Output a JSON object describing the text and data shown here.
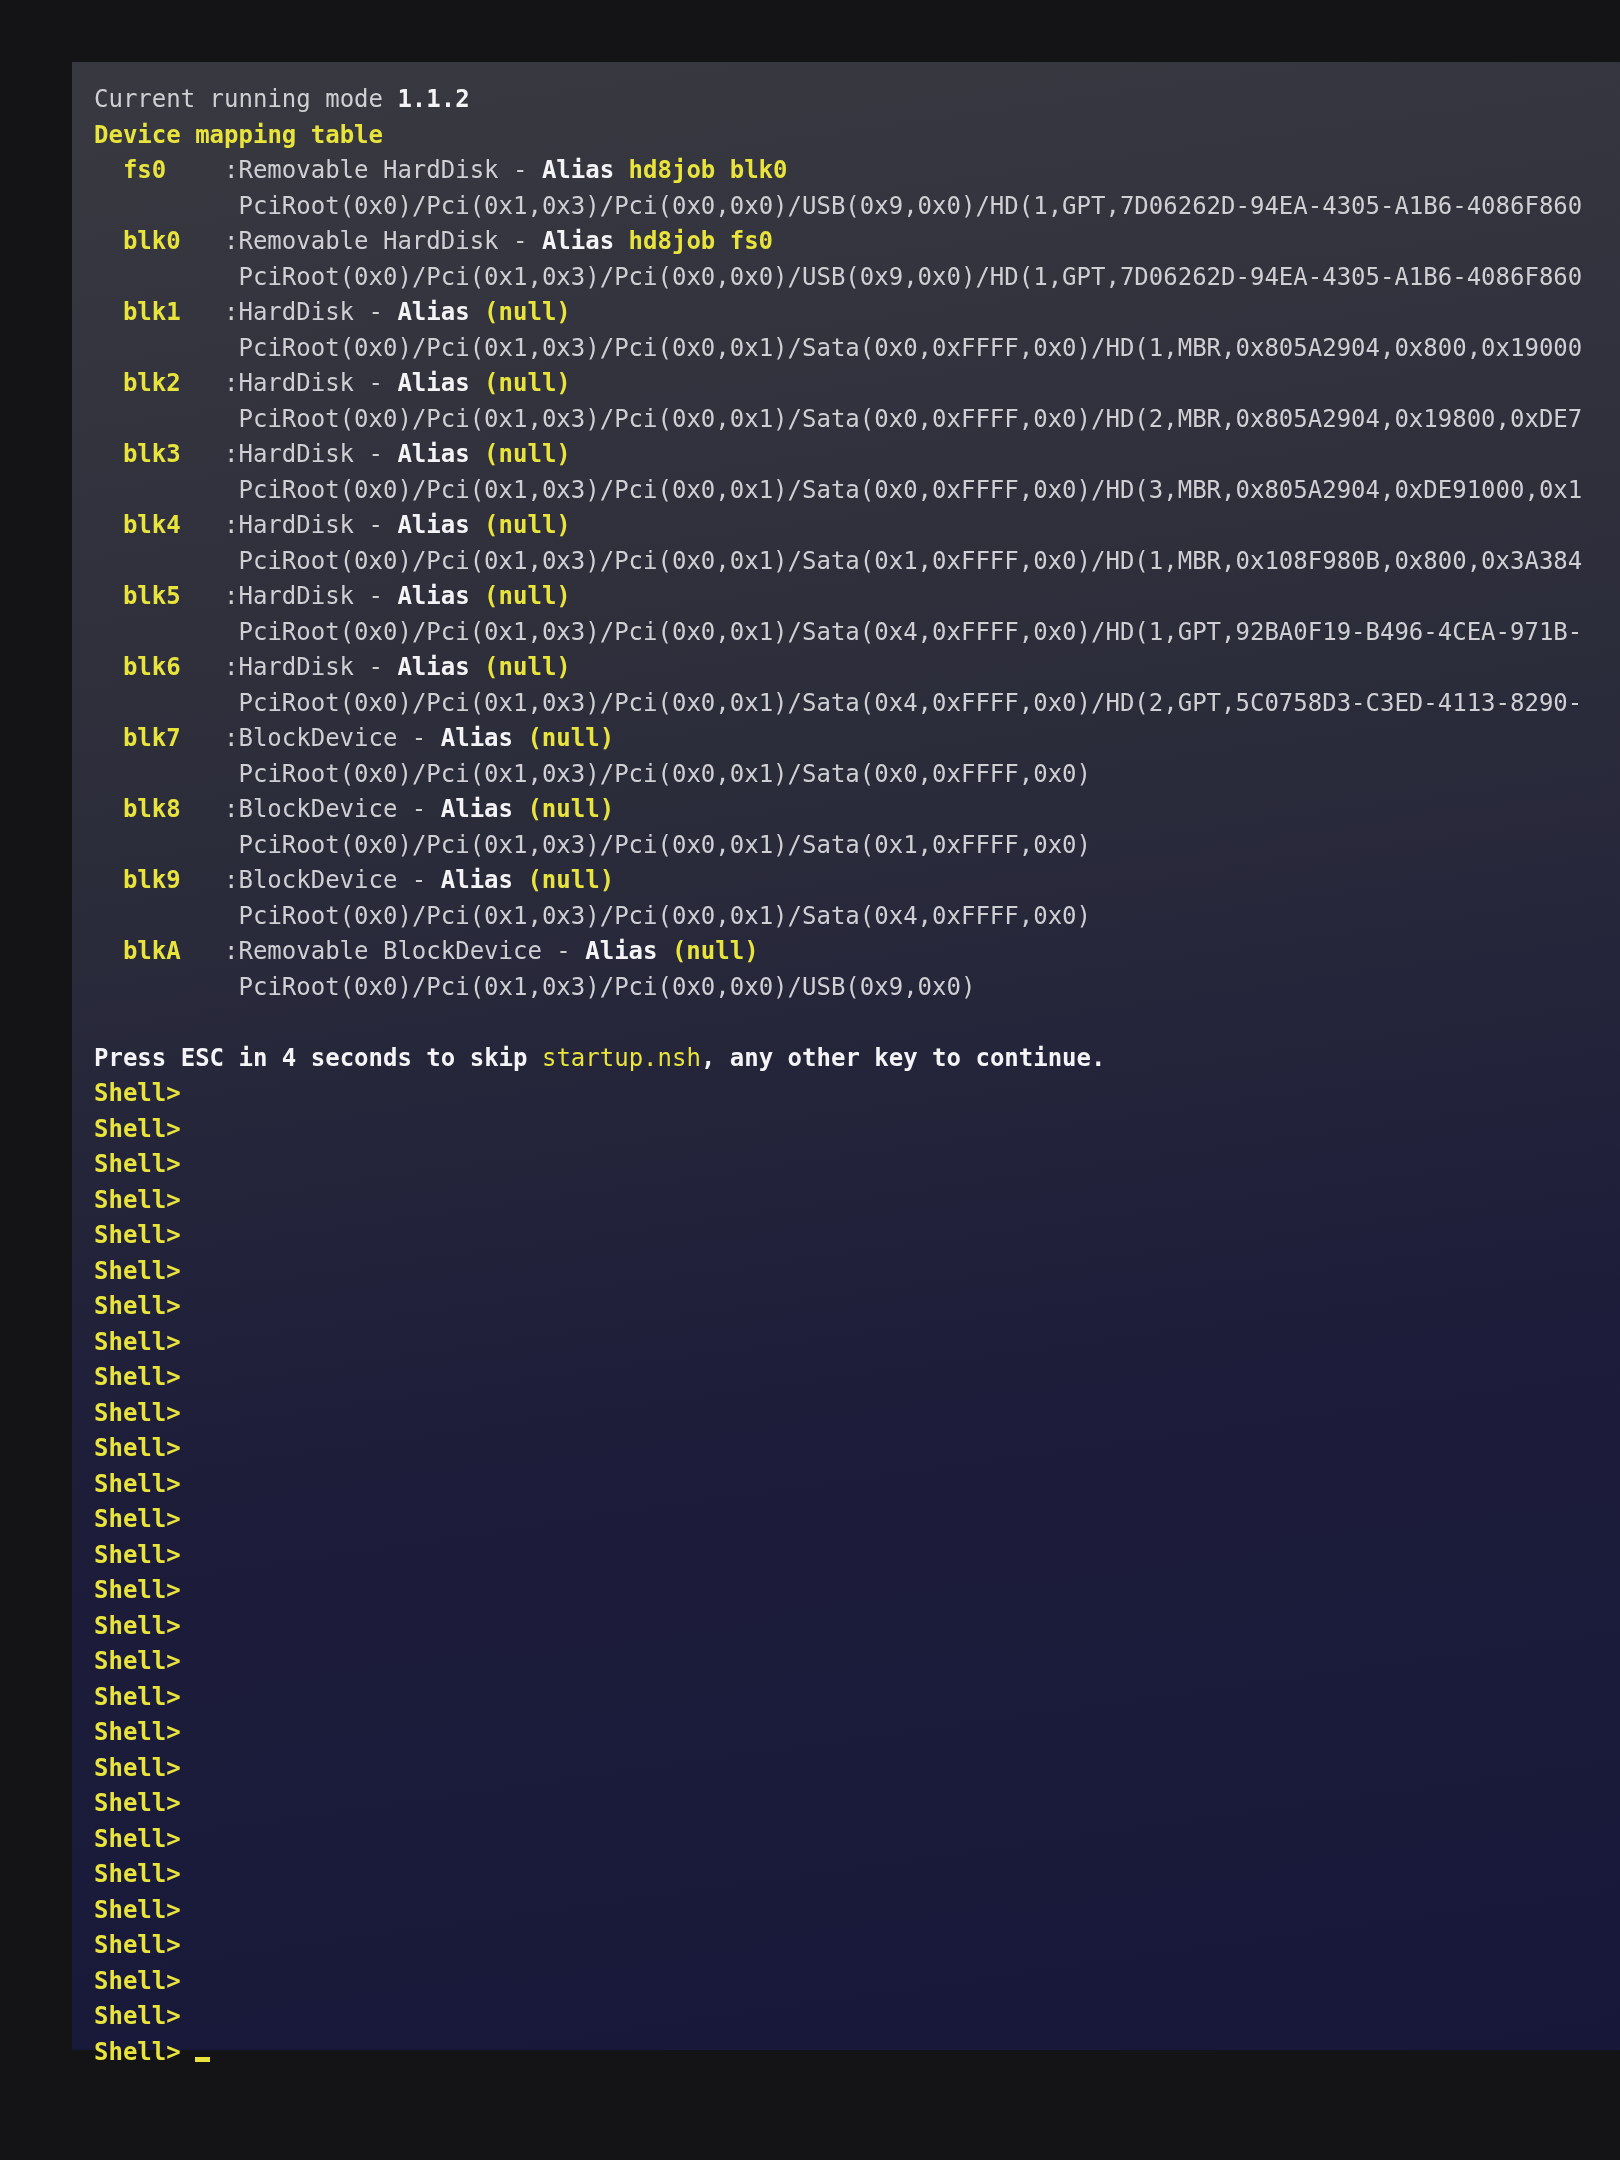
{
  "header": {
    "mode_label": "Current running mode",
    "mode_value": "1.1.2",
    "table_title": "Device mapping table"
  },
  "mappings": [
    {
      "name": "fs0",
      "type": ":Removable HardDisk",
      "dash": "-",
      "alias_label": "Alias",
      "alias": "hd8job blk0",
      "path": "PciRoot(0x0)/Pci(0x1,0x3)/Pci(0x0,0x0)/USB(0x9,0x0)/HD(1,GPT,7D06262D-94EA-4305-A1B6-4086F860"
    },
    {
      "name": "blk0",
      "type": ":Removable HardDisk",
      "dash": "-",
      "alias_label": "Alias",
      "alias": "hd8job fs0",
      "path": "PciRoot(0x0)/Pci(0x1,0x3)/Pci(0x0,0x0)/USB(0x9,0x0)/HD(1,GPT,7D06262D-94EA-4305-A1B6-4086F860"
    },
    {
      "name": "blk1",
      "type": ":HardDisk",
      "dash": "-",
      "alias_label": "Alias",
      "alias": "(null)",
      "path": "PciRoot(0x0)/Pci(0x1,0x3)/Pci(0x0,0x1)/Sata(0x0,0xFFFF,0x0)/HD(1,MBR,0x805A2904,0x800,0x19000"
    },
    {
      "name": "blk2",
      "type": ":HardDisk",
      "dash": "-",
      "alias_label": "Alias",
      "alias": "(null)",
      "path": "PciRoot(0x0)/Pci(0x1,0x3)/Pci(0x0,0x1)/Sata(0x0,0xFFFF,0x0)/HD(2,MBR,0x805A2904,0x19800,0xDE7"
    },
    {
      "name": "blk3",
      "type": ":HardDisk",
      "dash": "-",
      "alias_label": "Alias",
      "alias": "(null)",
      "path": "PciRoot(0x0)/Pci(0x1,0x3)/Pci(0x0,0x1)/Sata(0x0,0xFFFF,0x0)/HD(3,MBR,0x805A2904,0xDE91000,0x1"
    },
    {
      "name": "blk4",
      "type": ":HardDisk",
      "dash": "-",
      "alias_label": "Alias",
      "alias": "(null)",
      "path": "PciRoot(0x0)/Pci(0x1,0x3)/Pci(0x0,0x1)/Sata(0x1,0xFFFF,0x0)/HD(1,MBR,0x108F980B,0x800,0x3A384"
    },
    {
      "name": "blk5",
      "type": ":HardDisk",
      "dash": "-",
      "alias_label": "Alias",
      "alias": "(null)",
      "path": "PciRoot(0x0)/Pci(0x1,0x3)/Pci(0x0,0x1)/Sata(0x4,0xFFFF,0x0)/HD(1,GPT,92BA0F19-B496-4CEA-971B-"
    },
    {
      "name": "blk6",
      "type": ":HardDisk",
      "dash": "-",
      "alias_label": "Alias",
      "alias": "(null)",
      "path": "PciRoot(0x0)/Pci(0x1,0x3)/Pci(0x0,0x1)/Sata(0x4,0xFFFF,0x0)/HD(2,GPT,5C0758D3-C3ED-4113-8290-"
    },
    {
      "name": "blk7",
      "type": ":BlockDevice",
      "dash": "-",
      "alias_label": "Alias",
      "alias": "(null)",
      "path": "PciRoot(0x0)/Pci(0x1,0x3)/Pci(0x0,0x1)/Sata(0x0,0xFFFF,0x0)"
    },
    {
      "name": "blk8",
      "type": ":BlockDevice",
      "dash": "-",
      "alias_label": "Alias",
      "alias": "(null)",
      "path": "PciRoot(0x0)/Pci(0x1,0x3)/Pci(0x0,0x1)/Sata(0x1,0xFFFF,0x0)"
    },
    {
      "name": "blk9",
      "type": ":BlockDevice",
      "dash": "-",
      "alias_label": "Alias",
      "alias": "(null)",
      "path": "PciRoot(0x0)/Pci(0x1,0x3)/Pci(0x0,0x1)/Sata(0x4,0xFFFF,0x0)"
    },
    {
      "name": "blkA",
      "type": ":Removable BlockDevice",
      "dash": "-",
      "alias_label": "Alias",
      "alias": "(null)",
      "path": "PciRoot(0x0)/Pci(0x1,0x3)/Pci(0x0,0x0)/USB(0x9,0x0)"
    }
  ],
  "startup_message": {
    "before": "Press ESC in 4 seconds to skip ",
    "file": "startup.nsh",
    "after": ", any other key to continue."
  },
  "shell": {
    "prompts": [
      "Shell>",
      "Shell>",
      "Shell>",
      "Shell>",
      "Shell>",
      "Shell>",
      "Shell>",
      "Shell>",
      "Shell>",
      "Shell>",
      "Shell>",
      "Shell>",
      "Shell>",
      "Shell>",
      "Shell>",
      "Shell>",
      "Shell>",
      "Shell>",
      "Shell>",
      "Shell>",
      "Shell>",
      "Shell>",
      "Shell>",
      "Shell>",
      "Shell>",
      "Shell>",
      "Shell>",
      "Shell>"
    ],
    "cursor": true
  }
}
